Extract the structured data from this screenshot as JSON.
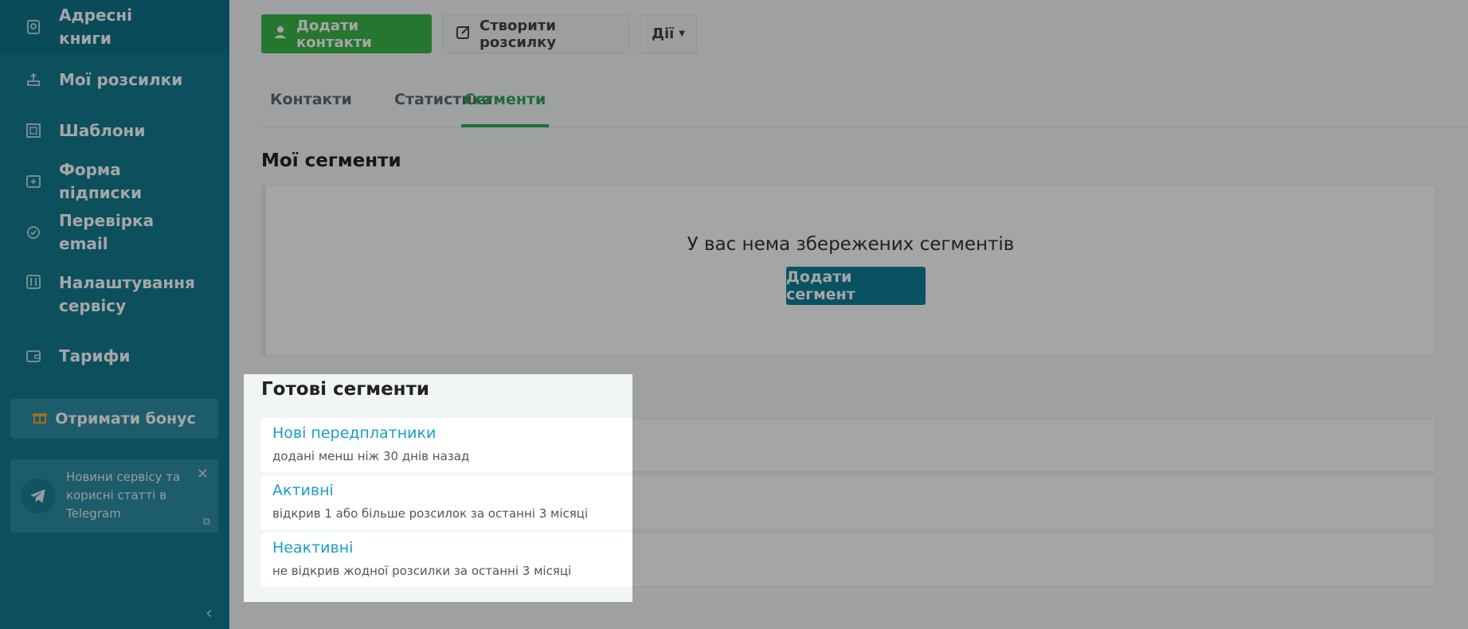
{
  "sidebar": {
    "items": [
      {
        "label": "Адресні книги",
        "icon": "address-book-icon"
      },
      {
        "label": "Мої розсилки",
        "icon": "mail-send-icon"
      },
      {
        "label": "Шаблони",
        "icon": "template-icon"
      },
      {
        "label": "Форма підписки",
        "icon": "subscribe-form-icon"
      },
      {
        "label": "Перевірка email",
        "icon": "check-icon"
      },
      {
        "label": "Налаштування сервісу",
        "icon": "settings-icon"
      },
      {
        "label": "Тарифи",
        "icon": "wallet-icon"
      }
    ],
    "bonus": {
      "label": "Отримати бонус",
      "icon": "gift-icon"
    },
    "telegram": {
      "text": "Новини сервісу та корисні статті в Telegram",
      "icon": "telegram-icon"
    }
  },
  "toolbar": {
    "add_contacts": "Додати контакти",
    "create_campaign": "Створити розсилку",
    "actions": "Дії"
  },
  "tabs": [
    "Контакти",
    "Статистика",
    "Сегменти"
  ],
  "active_tab": "Сегменти",
  "my_segments": {
    "title": "Мої сегменти",
    "empty_text": "У вас нема збережених сегментів",
    "add_button": "Додати сегмент"
  },
  "ready_segments": {
    "title": "Готові сегменти",
    "items": [
      {
        "title": "Нові передплатники",
        "desc": "додані менш ніж 30 днів назад"
      },
      {
        "title": "Активні",
        "desc": "відкрив 1 або більше розсилок за останні 3 місяці"
      },
      {
        "title": "Неактивні",
        "desc": "не відкрив жодної розсилки за останні 3 місяці"
      }
    ]
  },
  "colors": {
    "sidebar": "#137b91",
    "accent_green": "#3bb54a",
    "link": "#1a9fc0",
    "primary_button": "#0e7f98"
  }
}
